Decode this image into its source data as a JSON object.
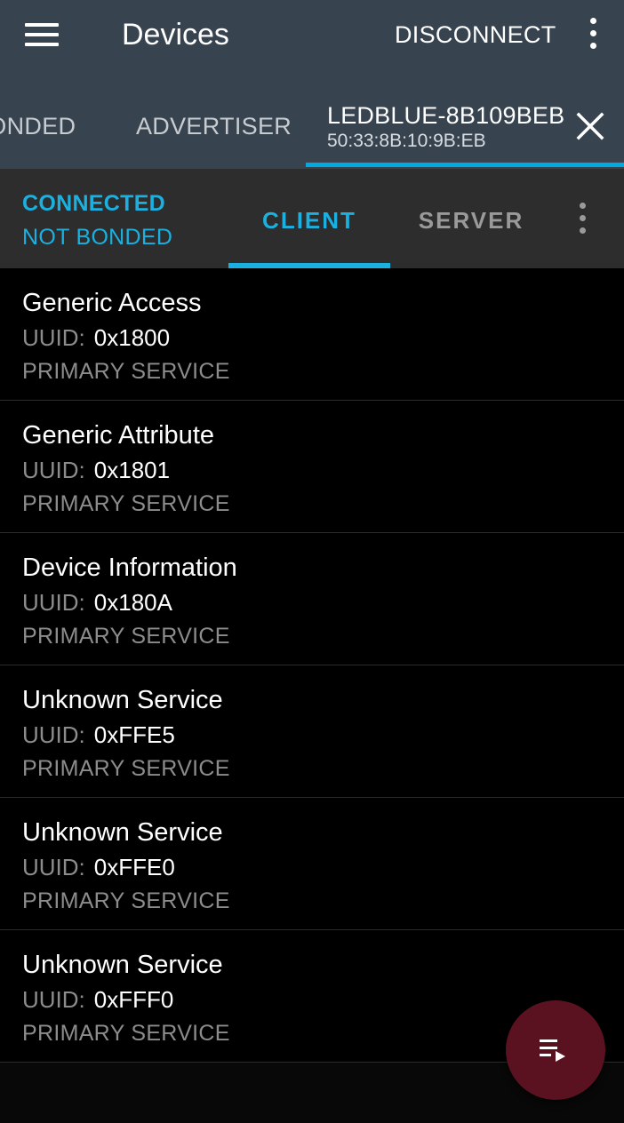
{
  "appbar": {
    "title": "Devices",
    "disconnect_label": "DISCONNECT"
  },
  "device_tabs": {
    "bonded_label": "BONDED",
    "advertiser_label": "ADVERTISER",
    "device_name": "LEDBLUE-8B109BEB",
    "device_mac": "50:33:8B:10:9B:EB"
  },
  "connection": {
    "state": "CONNECTED",
    "bond_state": "NOT BONDED"
  },
  "role_tabs": {
    "client_label": "CLIENT",
    "server_label": "SERVER",
    "selected": "CLIENT"
  },
  "services": [
    {
      "name": "Generic Access",
      "uuid_label": "UUID:",
      "uuid": "0x1800",
      "type": "PRIMARY SERVICE"
    },
    {
      "name": "Generic Attribute",
      "uuid_label": "UUID:",
      "uuid": "0x1801",
      "type": "PRIMARY SERVICE"
    },
    {
      "name": "Device Information",
      "uuid_label": "UUID:",
      "uuid": "0x180A",
      "type": "PRIMARY SERVICE"
    },
    {
      "name": "Unknown Service",
      "uuid_label": "UUID:",
      "uuid": "0xFFE5",
      "type": "PRIMARY SERVICE"
    },
    {
      "name": "Unknown Service",
      "uuid_label": "UUID:",
      "uuid": "0xFFE0",
      "type": "PRIMARY SERVICE"
    },
    {
      "name": "Unknown Service",
      "uuid_label": "UUID:",
      "uuid": "0xFFF0",
      "type": "PRIMARY SERVICE"
    }
  ],
  "icons": {
    "menu": "hamburger-menu-icon",
    "overflow": "vertical-dots-icon",
    "close": "close-x-icon",
    "fab": "playlist-play-icon"
  },
  "colors": {
    "toolbar": "#37434f",
    "accent": "#1ab1e1",
    "status_bar": "#2d2d2d",
    "fab": "#5b1220"
  }
}
